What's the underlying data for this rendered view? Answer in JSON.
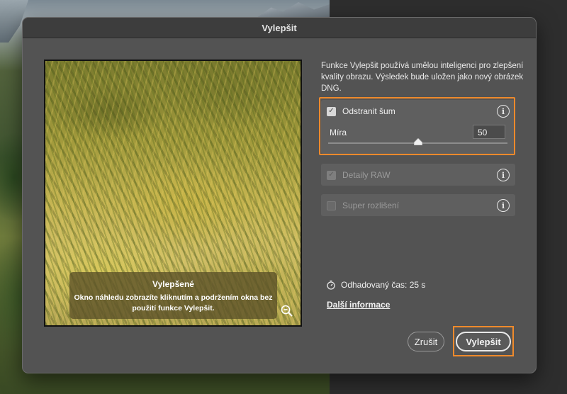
{
  "dialog": {
    "title": "Vylepšit"
  },
  "preview": {
    "overlay_title": "Vylepšené",
    "overlay_text": "Okno náhledu zobrazíte kliknutím a podržením okna bez použití funkce Vylepšit.",
    "zoom_icon": "zoom-out-icon"
  },
  "description": "Funkce Vylepšit používá umělou inteligenci pro zlepšení kvality obrazu. Výsledek bude uložen jako nový obrázek DNG.",
  "options": {
    "denoise": {
      "label": "Odstranit šum",
      "checked": true,
      "amount_label": "Míra",
      "amount_value": "50",
      "slider_value": 50,
      "slider_max": 100
    },
    "raw_details": {
      "label": "Detaily RAW",
      "checked": true,
      "disabled": true
    },
    "super_resolution": {
      "label": "Super rozlišení",
      "checked": false,
      "disabled": true
    }
  },
  "footer": {
    "estimate": "Odhadovaný čas: 25 s",
    "more_info": "Další informace",
    "cancel": "Zrušit",
    "enhance": "Vylepšit"
  },
  "colors": {
    "highlight": "#ef8a2c",
    "dialog_bg": "#535353"
  }
}
